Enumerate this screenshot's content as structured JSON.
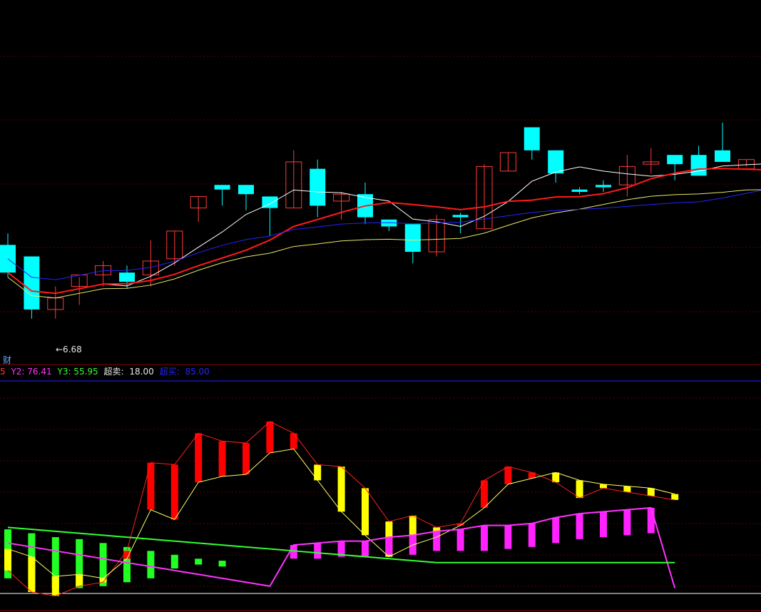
{
  "chart_data": [
    {
      "type": "candlestick",
      "panel": "price",
      "yrange": [
        6.5,
        8.0
      ],
      "colors": {
        "up": "#ff3b3b",
        "down": "#00ffff",
        "ma_white": "#ffffff",
        "ma_red": "#ff1a1a",
        "ma_yellow": "#e8e86a",
        "ma_blue": "#2424ff"
      },
      "candles": [
        {
          "o": 7.0,
          "h": 7.05,
          "l": 6.86,
          "c": 6.88
        },
        {
          "o": 6.95,
          "h": 6.95,
          "l": 6.68,
          "c": 6.72
        },
        {
          "o": 6.72,
          "h": 6.82,
          "l": 6.68,
          "c": 6.77
        },
        {
          "o": 6.82,
          "h": 6.86,
          "l": 6.74,
          "c": 6.87
        },
        {
          "o": 6.87,
          "h": 6.93,
          "l": 6.82,
          "c": 6.91
        },
        {
          "o": 6.88,
          "h": 6.91,
          "l": 6.81,
          "c": 6.84
        },
        {
          "o": 6.87,
          "h": 7.02,
          "l": 6.82,
          "c": 6.93
        },
        {
          "o": 6.94,
          "h": 7.06,
          "l": 6.91,
          "c": 7.06
        },
        {
          "o": 7.16,
          "h": 7.21,
          "l": 7.1,
          "c": 7.21
        },
        {
          "o": 7.26,
          "h": 7.26,
          "l": 7.17,
          "c": 7.24
        },
        {
          "o": 7.26,
          "h": 7.26,
          "l": 7.15,
          "c": 7.22
        },
        {
          "o": 7.21,
          "h": 7.21,
          "l": 7.04,
          "c": 7.16
        },
        {
          "o": 7.16,
          "h": 7.41,
          "l": 7.16,
          "c": 7.36
        },
        {
          "o": 7.33,
          "h": 7.37,
          "l": 7.12,
          "c": 7.17
        },
        {
          "o": 7.19,
          "h": 7.23,
          "l": 7.11,
          "c": 7.22
        },
        {
          "o": 7.22,
          "h": 7.27,
          "l": 7.09,
          "c": 7.12
        },
        {
          "o": 7.11,
          "h": 7.11,
          "l": 7.06,
          "c": 7.08
        },
        {
          "o": 7.09,
          "h": 7.09,
          "l": 6.92,
          "c": 6.97
        },
        {
          "o": 6.97,
          "h": 7.13,
          "l": 6.95,
          "c": 7.11
        },
        {
          "o": 7.13,
          "h": 7.14,
          "l": 7.05,
          "c": 7.12
        },
        {
          "o": 7.07,
          "h": 7.35,
          "l": 7.07,
          "c": 7.34
        },
        {
          "o": 7.32,
          "h": 7.4,
          "l": 7.32,
          "c": 7.4
        },
        {
          "o": 7.51,
          "h": 7.51,
          "l": 7.37,
          "c": 7.41
        },
        {
          "o": 7.41,
          "h": 7.41,
          "l": 7.27,
          "c": 7.31
        },
        {
          "o": 7.24,
          "h": 7.25,
          "l": 7.22,
          "c": 7.23
        },
        {
          "o": 7.26,
          "h": 7.28,
          "l": 7.23,
          "c": 7.25
        },
        {
          "o": 7.26,
          "h": 7.39,
          "l": 7.21,
          "c": 7.34
        },
        {
          "o": 7.35,
          "h": 7.42,
          "l": 7.31,
          "c": 7.36
        },
        {
          "o": 7.39,
          "h": 7.39,
          "l": 7.28,
          "c": 7.35
        },
        {
          "o": 7.39,
          "h": 7.43,
          "l": 7.33,
          "c": 7.3
        },
        {
          "o": 7.41,
          "h": 7.53,
          "l": 7.38,
          "c": 7.36
        },
        {
          "o": 7.33,
          "h": 7.37,
          "l": 7.34,
          "c": 7.37
        },
        {
          "o": 7.37,
          "h": 7.39,
          "l": 7.34,
          "c": 7.38
        }
      ],
      "annotations": [
        {
          "text": "←6.68"
        }
      ]
    },
    {
      "type": "indicator",
      "panel": "oscillator",
      "yrange": [
        -5,
        110
      ],
      "legend": [
        {
          "text": "5",
          "color": "#ff3b3b"
        },
        {
          "text": "Y2: 76.41",
          "color": "#ff33ff"
        },
        {
          "text": "Y3: 55.95",
          "color": "#33ff33"
        },
        {
          "text": "超卖:",
          "color": "#e6e6e6"
        },
        {
          "text": "18.00",
          "color": "#e6e6e6"
        },
        {
          "text": "超买:",
          "color": "#2424ff"
        },
        {
          "text": "85.00",
          "color": "#2424ff"
        }
      ],
      "levels": [
        {
          "name": "超卖",
          "value": 18.0
        },
        {
          "name": "超买",
          "value": 85.0
        }
      ],
      "bars": [
        {
          "from": 25,
          "to": 14,
          "color": "#ffff00"
        },
        {
          "from": 21,
          "to": 3,
          "color": "#ffff00"
        },
        {
          "from": 11,
          "to": 1,
          "color": "#ffff00"
        },
        {
          "from": 12,
          "to": 6,
          "color": "#ffff00"
        },
        {
          "from": 10,
          "to": 8,
          "color": "#ffff00"
        },
        {
          "from": 20,
          "to": 24,
          "color": "#ff0000"
        },
        {
          "from": 45,
          "to": 69,
          "color": "#ff0000"
        },
        {
          "from": 40,
          "to": 68,
          "color": "#ff0000"
        },
        {
          "from": 59,
          "to": 84,
          "color": "#ff0000"
        },
        {
          "from": 62,
          "to": 80,
          "color": "#ff0000"
        },
        {
          "from": 63,
          "to": 79,
          "color": "#ff0000"
        },
        {
          "from": 74,
          "to": 90,
          "color": "#ff0000"
        },
        {
          "from": 76,
          "to": 84,
          "color": "#ff0000"
        },
        {
          "from": 60,
          "to": 68,
          "color": "#ffff00"
        },
        {
          "from": 44,
          "to": 67,
          "color": "#ffff00"
        },
        {
          "from": 32,
          "to": 56,
          "color": "#ffff00"
        },
        {
          "from": 21,
          "to": 39,
          "color": "#ffff00"
        },
        {
          "from": 27,
          "to": 42,
          "color": "#ffff00"
        },
        {
          "from": 31,
          "to": 36,
          "color": "#ffff00"
        },
        {
          "from": 37,
          "to": 38,
          "color": "#ff0000"
        },
        {
          "from": 46,
          "to": 60,
          "color": "#ff0000"
        },
        {
          "from": 58,
          "to": 67,
          "color": "#ff0000"
        },
        {
          "from": 61,
          "to": 64,
          "color": "#ff0000"
        },
        {
          "from": 64,
          "to": 59,
          "color": "#ffff00"
        },
        {
          "from": 60,
          "to": 51,
          "color": "#ffff00"
        },
        {
          "from": 58,
          "to": 56,
          "color": "#ffff00"
        },
        {
          "from": 57,
          "to": 54,
          "color": "#ffff00"
        },
        {
          "from": 56,
          "to": 52,
          "color": "#ffff00"
        },
        {
          "from": 53,
          "to": 50,
          "color": "#ffff00"
        }
      ],
      "magenta_bars": [
        {
          "from": 20,
          "to": 27
        },
        {
          "from": 20,
          "to": 28
        },
        {
          "from": 21,
          "to": 29
        },
        {
          "from": 21,
          "to": 29
        },
        {
          "from": 22,
          "to": 31
        },
        {
          "from": 22,
          "to": 32
        },
        {
          "from": 24,
          "to": 34
        },
        {
          "from": 24,
          "to": 35
        },
        {
          "from": 24,
          "to": 37
        },
        {
          "from": 25,
          "to": 37
        },
        {
          "from": 26,
          "to": 38
        },
        {
          "from": 28,
          "to": 41
        },
        {
          "from": 30,
          "to": 43
        },
        {
          "from": 31,
          "to": 44
        },
        {
          "from": 32,
          "to": 45
        },
        {
          "from": 33,
          "to": 46
        }
      ],
      "green_bars": [
        {
          "from": 35,
          "to": 10
        },
        {
          "from": 33,
          "to": 8
        },
        {
          "from": 31,
          "to": 5
        },
        {
          "from": 30,
          "to": 5
        },
        {
          "from": 28,
          "to": 6
        },
        {
          "from": 26,
          "to": 8
        },
        {
          "from": 24,
          "to": 10
        },
        {
          "from": 22,
          "to": 15
        },
        {
          "from": 20,
          "to": 17
        },
        {
          "from": 19,
          "to": 16
        }
      ]
    }
  ],
  "labels": {
    "fin": "财"
  }
}
